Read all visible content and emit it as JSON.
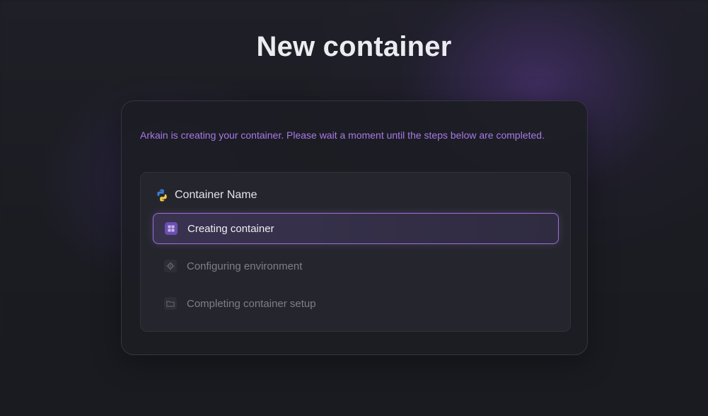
{
  "header": {
    "title": "New container"
  },
  "card": {
    "intro": "Arkain is creating your container. Please wait a moment until the steps below are completed."
  },
  "panel": {
    "title": "Container Name",
    "icon": "python-logo-icon"
  },
  "steps": [
    {
      "label": "Creating container",
      "status": "active",
      "icon": "container-icon"
    },
    {
      "label": "Configuring environment",
      "status": "pending",
      "icon": "gear-icon"
    },
    {
      "label": "Completing container setup",
      "status": "pending",
      "icon": "folder-icon"
    }
  ],
  "colors": {
    "accent": "#9b6fd9",
    "intro_text": "#a77ae6",
    "background": "#1b1c22"
  }
}
